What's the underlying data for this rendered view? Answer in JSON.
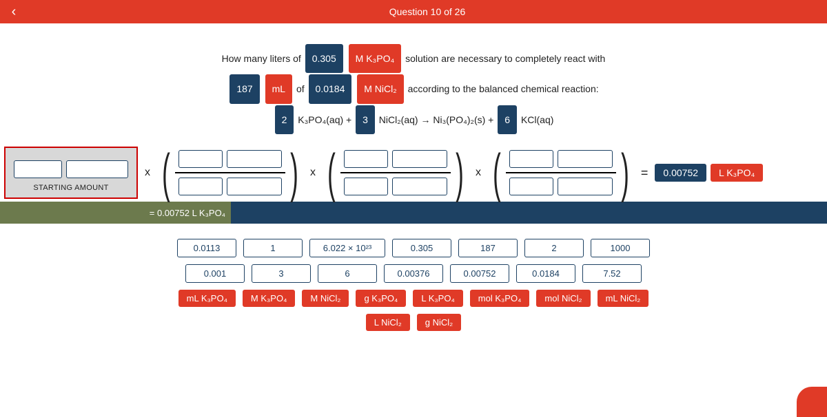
{
  "header": {
    "title": "Question 10 of 26"
  },
  "problem": {
    "line1_pre": "How many liters of ",
    "conc1": "0.305",
    "sp1": "M K₃PO₄",
    "line1_post": " solution are necessary to completely react with",
    "vol": "187",
    "vol_unit": "mL",
    "of": " of ",
    "conc2": "0.0184",
    "sp2": "M NiCl₂",
    "line2_post": " according to the balanced chemical reaction:",
    "c1": "2",
    "r1": "K₃PO₄(aq) + ",
    "c2": "3",
    "r2": "NiCl₂(aq) → Ni₃(PO₄)₂(s) + ",
    "c3": "6",
    "r3": "KCl(aq)"
  },
  "start_label": "STARTING AMOUNT",
  "ops": {
    "times": "x",
    "equals": "="
  },
  "answer": {
    "value": "0.00752",
    "unit": "L K₃PO₄"
  },
  "result_strip": "=  0.00752 L K₃PO₄",
  "bank_numbers_row1": [
    "0.0113",
    "1",
    "6.022 × 10²³",
    "0.305",
    "187",
    "2",
    "1000"
  ],
  "bank_numbers_row2": [
    "0.001",
    "3",
    "6",
    "0.00376",
    "0.00752",
    "0.0184",
    "7.52"
  ],
  "bank_units_row1": [
    "mL K₃PO₄",
    "M K₃PO₄",
    "M NiCl₂",
    "g K₃PO₄",
    "L K₃PO₄",
    "mol K₃PO₄",
    "mol NiCl₂",
    "mL NiCl₂"
  ],
  "bank_units_row2": [
    "L NiCl₂",
    "g NiCl₂"
  ]
}
